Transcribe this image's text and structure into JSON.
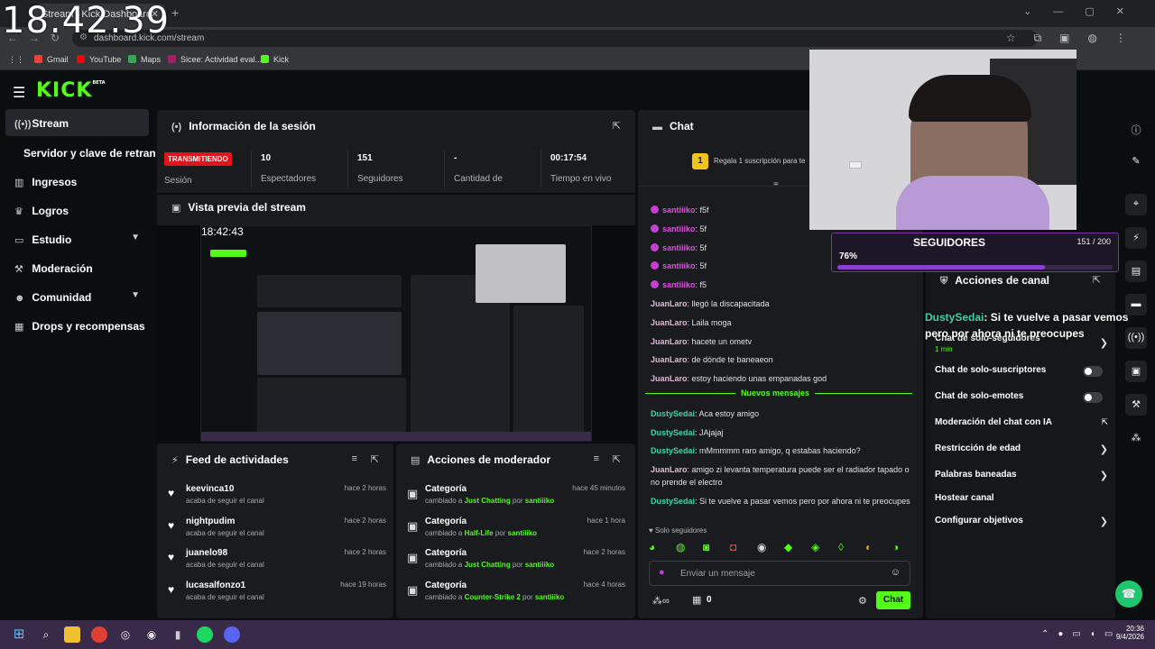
{
  "browser": {
    "tab_title": "Stream | Kick Dashboard",
    "url": "dashboard.kick.com/stream",
    "overlay_clock": "18.42.39",
    "bookmarks": [
      "Gmail",
      "YouTube",
      "Maps",
      "Sicee: Actividad eval...",
      "Kick"
    ]
  },
  "brand": {
    "logo": "KICK",
    "beta": "BETA",
    "accent": "#53fc18"
  },
  "sidebar": {
    "items": [
      {
        "label": "Stream",
        "icon": "broadcast-icon"
      },
      {
        "label": "Servidor y clave de retransmisión"
      },
      {
        "label": "Ingresos",
        "icon": "chart-icon"
      },
      {
        "label": "Logros",
        "icon": "trophy-icon"
      },
      {
        "label": "Estudio",
        "icon": "studio-icon"
      },
      {
        "label": "Moderación",
        "icon": "hammer-icon"
      },
      {
        "label": "Comunidad",
        "icon": "community-icon"
      },
      {
        "label": "Drops y recompensas",
        "icon": "gift-icon"
      }
    ]
  },
  "session": {
    "title": "Información de la sesión",
    "status": "TRANSMITIENDO",
    "status_label": "Sesión",
    "stats": [
      {
        "value": "10",
        "label": "Espectadores"
      },
      {
        "value": "151",
        "label": "Seguidores"
      },
      {
        "value": "-",
        "label": "Cantidad de"
      },
      {
        "value": "00:17:54",
        "label": "Tiempo en vivo"
      }
    ]
  },
  "preview": {
    "title": "Vista previa del stream",
    "clock": "18:42:43"
  },
  "feed": {
    "title": "Feed de actividades",
    "items": [
      {
        "name": "keevinca10",
        "desc": "acaba de seguir el canal",
        "time": "hace 2 horas"
      },
      {
        "name": "nightpudim",
        "desc": "acaba de seguir el canal",
        "time": "hace 2 horas"
      },
      {
        "name": "juanelo98",
        "desc": "acaba de seguir el canal",
        "time": "hace 2 horas"
      },
      {
        "name": "lucasalfonzo1",
        "desc": "acaba de seguir el canal",
        "time": "hace 19 horas"
      }
    ]
  },
  "modactions": {
    "title": "Acciones de moderador",
    "items": [
      {
        "name": "Categoría",
        "prefix": "cambiado a ",
        "category": "Just Chatting",
        "by": " por ",
        "user": "santiiiko",
        "time": "hace 45 minutos"
      },
      {
        "name": "Categoría",
        "prefix": "cambiado a ",
        "category": "Half-Life",
        "by": " por ",
        "user": "santiiiko",
        "time": "hace 1 hora"
      },
      {
        "name": "Categoría",
        "prefix": "cambiado a ",
        "category": "Just Chatting",
        "by": " por ",
        "user": "santiiiko",
        "time": "hace 2 horas"
      },
      {
        "name": "Categoría",
        "prefix": "cambiado a ",
        "category": "Counter-Strike 2",
        "by": " por ",
        "user": "santiiiko",
        "time": "hace 4 horas"
      }
    ]
  },
  "chat": {
    "title": "Chat",
    "gift_count": "1",
    "gift_text": "Regala 1 suscripción para te",
    "messages": [
      {
        "user": "santiiiko",
        "text": ": f5f",
        "color": "#e04fe0",
        "badge": true
      },
      {
        "user": "santiiiko",
        "text": ": 5f",
        "color": "#e04fe0",
        "badge": true
      },
      {
        "user": "santiiiko",
        "text": ": 5f",
        "color": "#e04fe0",
        "badge": true
      },
      {
        "user": "santiiiko",
        "text": ": 5f",
        "color": "#e04fe0",
        "badge": true
      },
      {
        "user": "santiiiko",
        "text": ": f5",
        "color": "#e04fe0",
        "badge": true
      },
      {
        "user": "JuanLaro",
        "text": ": llegó la discapacitada",
        "color": "#e0b8d8",
        "badge": false
      },
      {
        "user": "JuanLaro",
        "text": ": Laila moga",
        "color": "#e0b8d8",
        "badge": false
      },
      {
        "user": "JuanLaro",
        "text": ": hacete un ometv",
        "color": "#e0b8d8",
        "badge": false
      },
      {
        "user": "JuanLaro",
        "text": ": de dónde te baneaeon",
        "color": "#e0b8d8",
        "badge": false
      },
      {
        "user": "JuanLaro",
        "text": ": estoy haciendo unas empanadas god",
        "color": "#e0b8d8",
        "badge": false
      }
    ],
    "new_messages_label": "Nuevos mensajes",
    "new_messages": [
      {
        "user": "DustySedai",
        "text": ": Aca estoy amigo",
        "color": "#3fd4a8"
      },
      {
        "user": "DustySedai",
        "text": ": JAjajaj",
        "color": "#3fd4a8"
      },
      {
        "user": "DustySedai",
        "text": ": mMmmmm raro amigo, q estabas haciendo?",
        "color": "#3fd4a8"
      },
      {
        "user": "JuanLaro",
        "text": ": amigo zi levanta temperatura puede ser el radiador tapado o no prende el electro",
        "color": "#e0b8d8"
      },
      {
        "user": "DustySedai",
        "text": ": Si te vuelve a pasar vemos pero por ahora ni te preocupes",
        "color": "#3fd4a8"
      }
    ],
    "followers_only": "Solo seguidores",
    "input_placeholder": "Enviar un mensaje",
    "points": "0",
    "send_label": "Chat"
  },
  "overlay": {
    "followers_title": "SEGUIDORES",
    "followers_count": "151 / 200",
    "followers_percent": "76%",
    "followers_progress": 0.755,
    "alert_user": "DustySedai",
    "alert_text": ": Si te vuelve a pasar vemos pero por ahora ni te preocupes",
    "alert_time": "1 min"
  },
  "channel_actions": {
    "title": "Acciones de canal",
    "items": [
      {
        "label": "Chat de solo-seguidores",
        "kind": "chevron"
      },
      {
        "label": "Chat de solo-suscriptores",
        "kind": "toggle"
      },
      {
        "label": "Chat de solo-emotes",
        "kind": "toggle"
      },
      {
        "label": "Moderación del chat con IA",
        "kind": "external"
      },
      {
        "label": "Restricción de edad",
        "kind": "chevron"
      },
      {
        "label": "Palabras baneadas",
        "kind": "chevron"
      },
      {
        "label": "Hostear canal",
        "kind": "none"
      },
      {
        "label": "Configurar objetivos",
        "kind": "chevron"
      }
    ]
  },
  "taskbar": {
    "time": "20:36",
    "date": "9/4/2026",
    "bg": "#3a2a4a"
  }
}
